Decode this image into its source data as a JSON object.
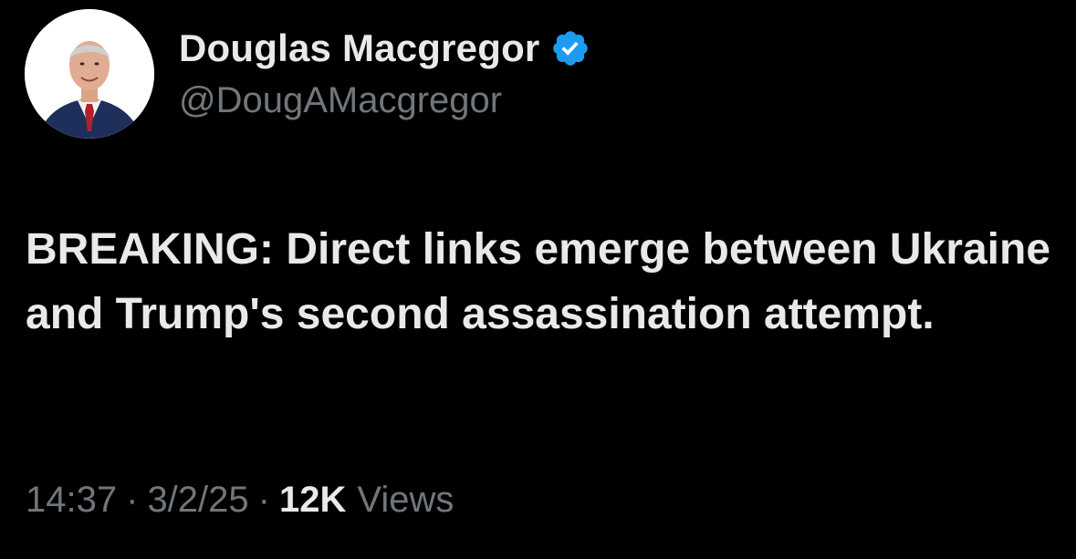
{
  "author": {
    "display_name": "Douglas Macgregor",
    "handle": "@DougAMacgregor",
    "verified_badge_color": "#1d9bf0",
    "avatar": "profile-photo"
  },
  "tweet": {
    "text": "BREAKING: Direct links emerge between Ukraine and Trump's second assassination attempt.",
    "time": "14:37",
    "separator": "·",
    "date": "3/2/25",
    "views_count": "12K",
    "views_label": "Views"
  },
  "colors": {
    "background": "#000000",
    "primary_text": "#e7e9ea",
    "secondary_text": "#71767b"
  }
}
